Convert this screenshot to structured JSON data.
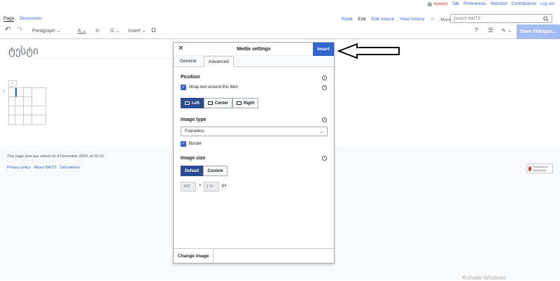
{
  "personal": {
    "user": "Admin3",
    "links": [
      "Talk",
      "Preferences",
      "Watchlist",
      "Contributions",
      "Log out"
    ]
  },
  "tabs_left": [
    "Page",
    "Discussion"
  ],
  "tabs_right": {
    "read": "Read",
    "edit": "Edit",
    "edit_source": "Edit source",
    "history": "View history",
    "star": "☆",
    "more": "More ⌄"
  },
  "search": {
    "placeholder": "Search NAITS",
    "icon": "search-icon"
  },
  "toolbar": {
    "undo": "↶",
    "redo": "↷",
    "paragraph": "Paragraph ⌄",
    "style": "A ⌄",
    "link": "⊝",
    "list": "☰ ⌄",
    "insert": "Insert ⌄",
    "special": "Ω",
    "help": "?",
    "menu": "☰",
    "pen": "✎ ⌄",
    "save": "Save changes..."
  },
  "page": {
    "heading": "ტესტი"
  },
  "footer": {
    "edited": "This page was last edited on 4 November 2024, at 06:10.",
    "links": [
      "Privacy policy",
      "About NAITS",
      "Disclaimers"
    ],
    "powered": "Powered by MediaWiki"
  },
  "watermark": "Activate Windows",
  "dialog": {
    "close": "✕",
    "title": "Media settings",
    "insert": "Insert",
    "tabs": {
      "general": "General",
      "advanced": "Advanced"
    },
    "position": {
      "label": "Position",
      "wrap": "Wrap text around this item",
      "left": "Left",
      "center": "Center",
      "right": "Right"
    },
    "image_type": {
      "label": "Image type",
      "value": "Frameless",
      "border": "Border"
    },
    "image_size": {
      "label": "Image size",
      "default": "Default",
      "custom": "Custom",
      "width": "300",
      "x": "×",
      "height": "173",
      "unit": "px"
    },
    "change_image": "Change image",
    "info": "i"
  },
  "colors": {
    "accent": "#3366cc",
    "selected": "#2a4b8d",
    "save_disabled": "#a2bbf0"
  }
}
